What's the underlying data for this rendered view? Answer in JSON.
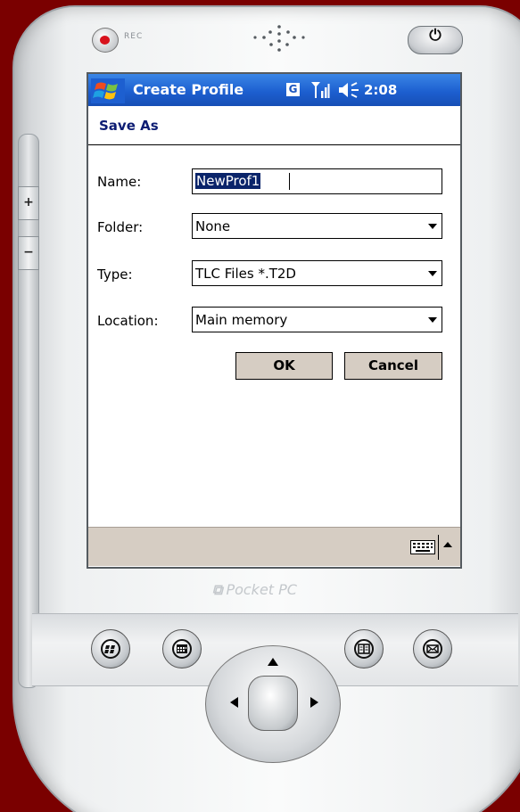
{
  "device": {
    "rec_label": "REC",
    "brand": "Pocket PC"
  },
  "titlebar": {
    "title": "Create Profile",
    "notification": "G",
    "clock": "2:08"
  },
  "form": {
    "header": "Save As",
    "name_label": "Name:",
    "name_value": "NewProf1",
    "folder_label": "Folder:",
    "folder_value": "None",
    "type_label": "Type:",
    "type_value": "TLC Files *.T2D",
    "location_label": "Location:",
    "location_value": "Main memory",
    "ok_label": "OK",
    "cancel_label": "Cancel"
  },
  "icons": {
    "start": "windows-flag-icon",
    "signal": "signal-strength-icon",
    "volume": "volume-icon",
    "keyboard": "keyboard-icon",
    "hw_buttons": [
      "windows-start-icon",
      "calendar-icon",
      "contacts-icon",
      "inbox-icon"
    ]
  },
  "colors": {
    "titlebar": "#1d5fd0",
    "header_text": "#0c1c73",
    "button_face": "#d6cdc3",
    "selection": "#0a246a",
    "background": "#7a0000"
  }
}
